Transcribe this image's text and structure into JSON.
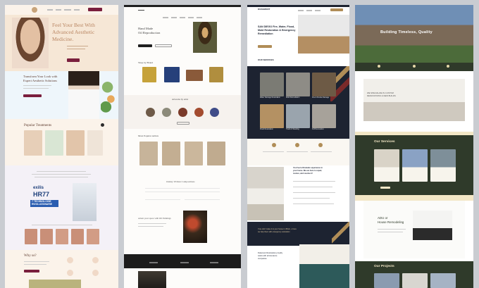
{
  "col1": {
    "hero_title": [
      "Feel Your Best With",
      "Advanced Aesthetic",
      "Medicine."
    ],
    "section_transform": [
      "Transform Your Look with",
      "Expert Aesthetic Solutions"
    ],
    "popular_treatments": "Popular Treatments",
    "product_brand": "exilis",
    "product_model": "HR77",
    "product_tag": [
      "7 TECHNOLOGIE",
      "RIVOLUZIONARIE"
    ],
    "why_us": "Why us?"
  },
  "col2": {
    "hero_title": [
      "Hand Made",
      "Oil Reproduction"
    ],
    "shop_by_brand": "Shop by Brand",
    "artists": "Artworks by artist",
    "most_popular": "Most Popular Artists",
    "gallery_heading": "Oakley Written Compositions",
    "feature_heading": "Adorn your space with Oil Paintings"
  },
  "col3": {
    "logo_text": "DUKEMONT",
    "hero_title": [
      "SAN DIEGO Fire, Water, Flood,",
      "Mold Restoration & Emergency",
      "Remediation"
    ],
    "services": "OUR SERVICES",
    "cards": [
      "Water Damage Restoration",
      "Mold Remediation",
      "Fire & Smoke Damage",
      "Flood Restoration",
      "Trash & Hoarding",
      "Full Renovation"
    ],
    "cta_title": [
      "You Feel a Dramatic experience in",
      "your home. We are here to repair,",
      "restore, and resolve it!"
    ],
    "quote_lines": [
      "If we don't make it to your house in 45min, or less",
      "we help them with emergency restoration"
    ],
    "bottom_lines": [
      "Dukemont Restoration proudly",
      "works with all insurance",
      "companies."
    ]
  },
  "col4": {
    "hero_title": "Building Timeless, Quality",
    "intro_lines": [
      "WE SPECIALIZE IN CUSTOM",
      "RENOVATIONS & NEW BUILDS"
    ],
    "services": "Our Services",
    "adu_title": [
      "ADU or",
      "House Remodeling"
    ],
    "projects": "Our Projects"
  },
  "colors": {
    "c1_accent": "#7a1f3d",
    "c2_dark": "#1f1f1f",
    "c3_navy": "#1d2331",
    "c3_gold": "#b08d57",
    "c4_green": "#2f3a2a",
    "c4_cream": "#f3e7c6"
  }
}
